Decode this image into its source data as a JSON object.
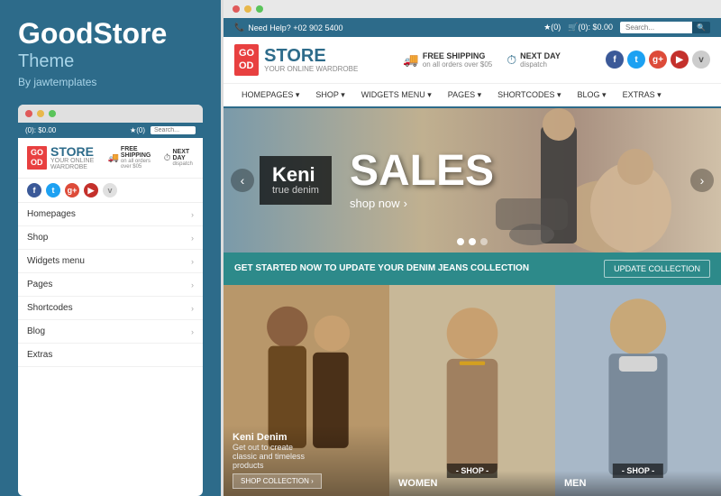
{
  "left": {
    "title": "GoodStore",
    "subtitle": "Theme",
    "author": "By jawtemplates",
    "browser_dots": [
      "red",
      "yellow",
      "green"
    ],
    "topbar": {
      "cart": "(0): $0.00",
      "wishlist": "★(0)"
    },
    "logo": {
      "box": "GO\nOD",
      "store": "STORE",
      "tagline": "YOUR ONLINE WARDROBE"
    },
    "shipping": {
      "free_label": "FREE SHIPPING",
      "free_sub": "on all orders over $05",
      "next_label": "NEXT DAY",
      "next_sub": "dispatch"
    },
    "nav_items": [
      {
        "label": "Homepages",
        "id": "homepages"
      },
      {
        "label": "Shop",
        "id": "shop"
      },
      {
        "label": "Widgets menu",
        "id": "widgets"
      },
      {
        "label": "Pages",
        "id": "pages"
      },
      {
        "label": "Shortcodes",
        "id": "shortcodes"
      },
      {
        "label": "Blog",
        "id": "blog"
      },
      {
        "label": "Extras",
        "id": "extras"
      }
    ]
  },
  "right": {
    "browser_dots": [
      "red",
      "yellow",
      "green"
    ],
    "topbar": {
      "need_help": "Need Help? +02 902 5400",
      "wishlist": "★(0)",
      "cart": "🛒(0): $0.00",
      "search_placeholder": "Search..."
    },
    "logo": {
      "box": "GO\nOD",
      "store": "STORE",
      "tagline": "YOUR ONLINE WARDROBE"
    },
    "shipping": {
      "free_label": "FREE SHIPPING",
      "free_sub": "on all orders over $05",
      "next_label": "NEXT DAY",
      "next_sub": "dispatch"
    },
    "nav": {
      "items": [
        "HOMEPAGES",
        "SHOP",
        "WIDGETS MENU",
        "PAGES",
        "SHORTCODES",
        "BLOG",
        "EXTRAS"
      ]
    },
    "hero": {
      "brand": "Keni",
      "brand_sub": "true denim",
      "sales_text": "SALES",
      "shop_now": "shop now",
      "dots": [
        true,
        true,
        false
      ]
    },
    "banner": {
      "text": "GET STARTED NOW TO UPDATE YOUR DENIM JEANS\nCOLLECTION",
      "button": "UPDATE COLLECTION"
    },
    "products": [
      {
        "id": "keni-denim",
        "name": "Keni Denim",
        "desc": "Get out to create\nclassic and timeless\nproducts",
        "cta": "SHOP COLLECTION >",
        "shop_label": ""
      },
      {
        "id": "women",
        "name": "WOMEN",
        "desc": "",
        "cta": "",
        "shop_label": "- SHOP -"
      },
      {
        "id": "men",
        "name": "MEN",
        "desc": "",
        "cta": "",
        "shop_label": "- SHOP -"
      }
    ]
  },
  "social": {
    "fb": "f",
    "tw": "t",
    "gp": "g+",
    "yt": "▶",
    "vi": "v"
  },
  "colors": {
    "primary": "#2d6b8a",
    "accent": "#e84040",
    "teal": "#2d8a8a"
  }
}
